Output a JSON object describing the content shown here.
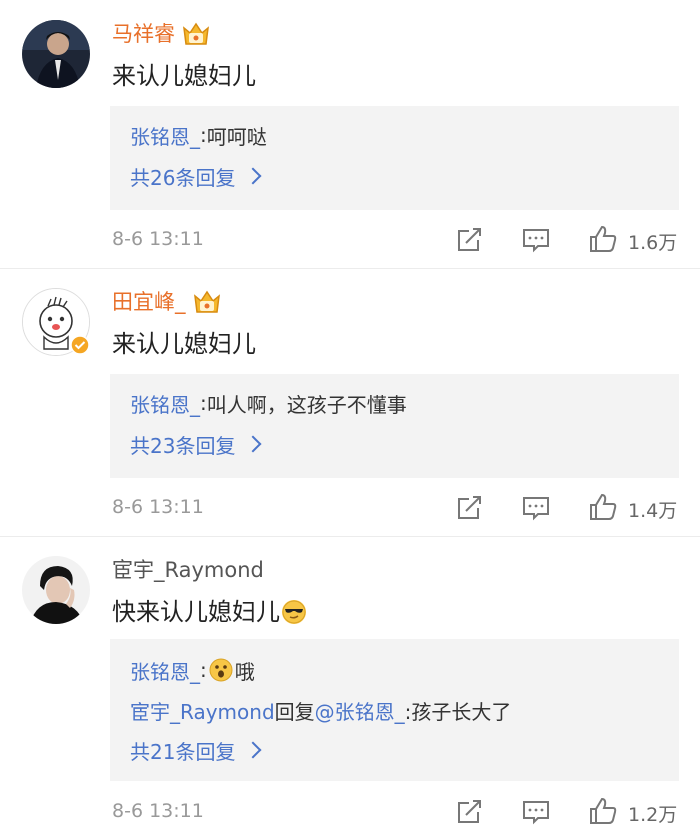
{
  "comments": [
    {
      "user": "马祥睿",
      "text": "来认儿媳妇儿",
      "replies": [
        {
          "name": "张铭恩_",
          "sep": ": ",
          "text": "呵呵哒"
        }
      ],
      "more": "共26条回复",
      "time": "8-6 13:11",
      "likes": "1.6万"
    },
    {
      "user": "田宜峰_",
      "text": "来认儿媳妇儿",
      "replies": [
        {
          "name": "张铭恩_",
          "sep": ": ",
          "text": "叫人啊，这孩子不懂事"
        }
      ],
      "more": "共23条回复",
      "time": "8-6 13:11",
      "likes": "1.4万"
    },
    {
      "user": "宦宇_Raymond",
      "text": "快来认儿媳妇儿",
      "replies": [
        {
          "name": "张铭恩_",
          "sep": ": ",
          "text": "哦"
        },
        {
          "name": "宦宇_Raymond",
          "mid": "回复",
          "mention": "@张铭恩_",
          "text": ":孩子长大了"
        }
      ],
      "more": "共21条回复",
      "time": "8-6 13:11",
      "likes": "1.2万"
    }
  ],
  "colors": {
    "username_vip": "#e8702a",
    "link": "#4a74c9",
    "meta": "#999999",
    "reply_bg": "#f3f3f3"
  },
  "icons": [
    "crown-icon",
    "verified-icon",
    "repost-icon",
    "comment-icon",
    "like-icon",
    "chevron-right-icon",
    "surprised-emoji-icon",
    "cool-emoji-icon"
  ]
}
